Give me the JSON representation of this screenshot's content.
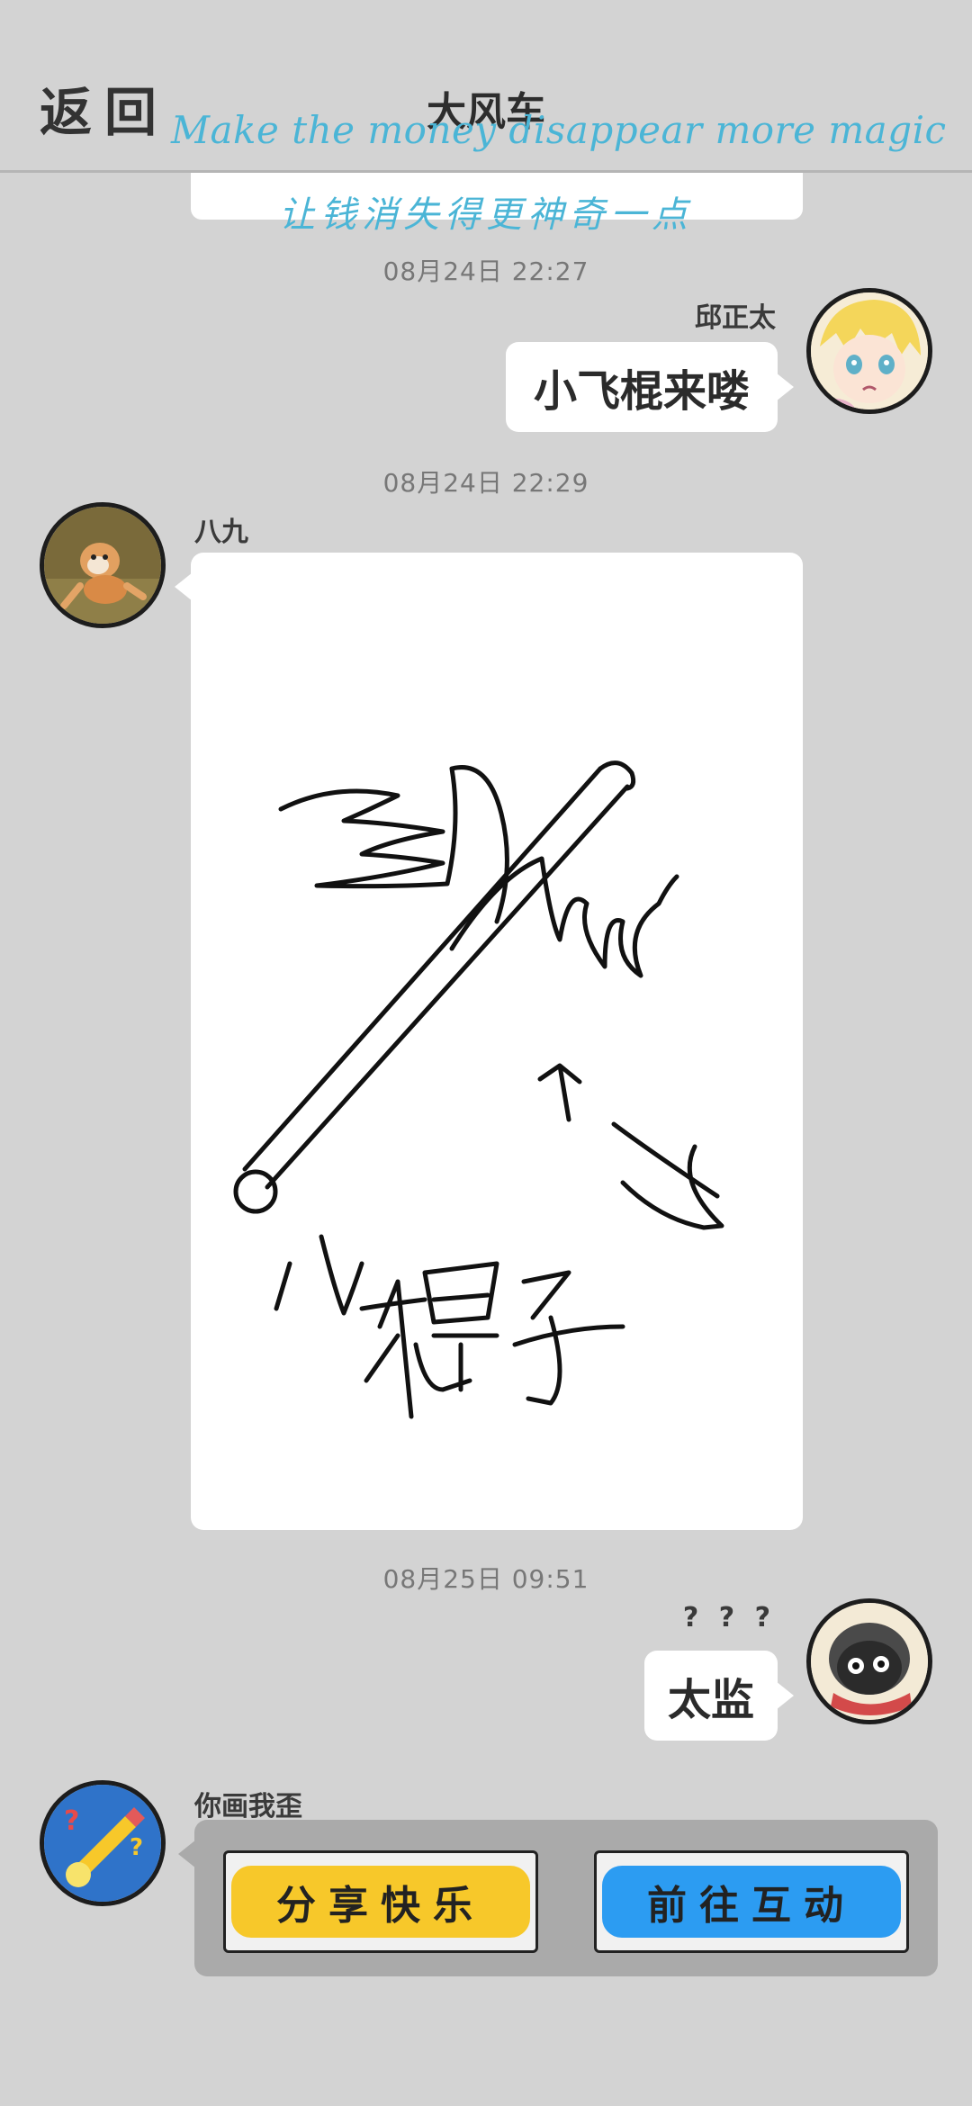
{
  "header": {
    "back_label": "返回",
    "title": "大风车",
    "watermark_en": "Make the money disappear more magic",
    "watermark_cn": "让钱消失得更神奇一点"
  },
  "messages": [
    {
      "timestamp": "08月24日  22:27",
      "sender": "邱正太",
      "side": "right",
      "text": "小飞棍来喽"
    },
    {
      "timestamp": "08月24日  22:29",
      "sender": "八九",
      "side": "left",
      "type": "drawing",
      "drawing_text": [
        "小",
        "飞",
        "棍子"
      ]
    },
    {
      "timestamp": "08月25日  09:51",
      "sender": "? ? ?",
      "side": "right",
      "text": "太监"
    },
    {
      "sender": "你画我歪",
      "side": "left",
      "type": "game-card",
      "buttons": [
        {
          "label": "分享快乐",
          "color": "#f7c82a"
        },
        {
          "label": "前往互动",
          "color": "#2c9cf2"
        }
      ]
    }
  ],
  "colors": {
    "background": "#d3d3d3",
    "bubble": "#ffffff",
    "watermark": "#4bb5d6"
  }
}
